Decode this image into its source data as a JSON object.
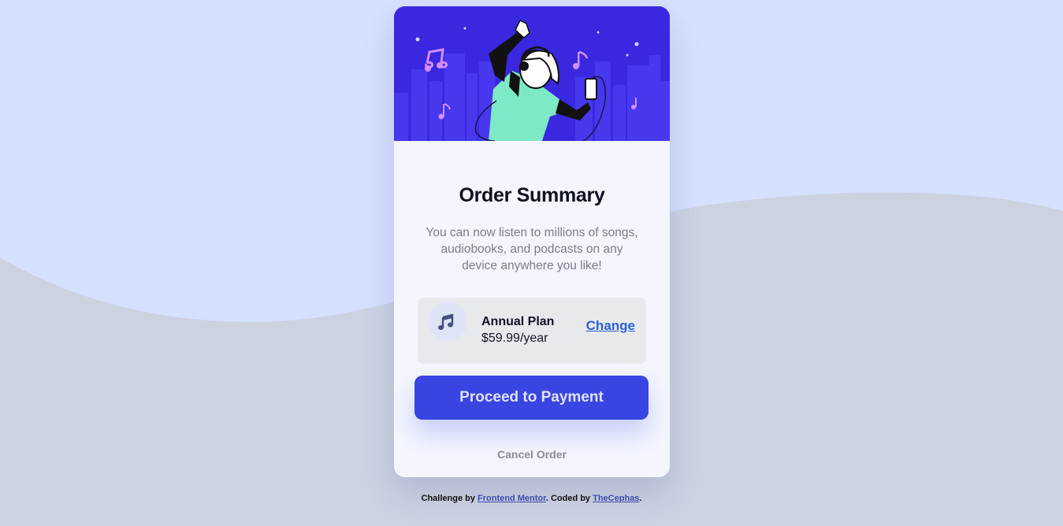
{
  "card": {
    "title": "Order Summary",
    "description": "You can now listen to millions of songs, audiobooks, and podcasts on any device anywhere you like!",
    "plan": {
      "icon": "music-note-icon",
      "name": "Annual Plan",
      "price": "$59.99/year",
      "change_label": "Change"
    },
    "pay_label": "Proceed to Payment",
    "cancel_label": "Cancel Order"
  },
  "footer": {
    "prefix": "Challenge by ",
    "link1": "Frontend Mentor",
    "middle": ". Coded by ",
    "link2": "TheCephas",
    "suffix": "."
  },
  "colors": {
    "page_bg_light": "#d6e0ff",
    "page_bg_wave": "#cdd2e1",
    "hero_bg": "#3a27e0",
    "card_bg": "#f3f6ff",
    "accent": "#3845e0",
    "link": "#2a62d1"
  }
}
